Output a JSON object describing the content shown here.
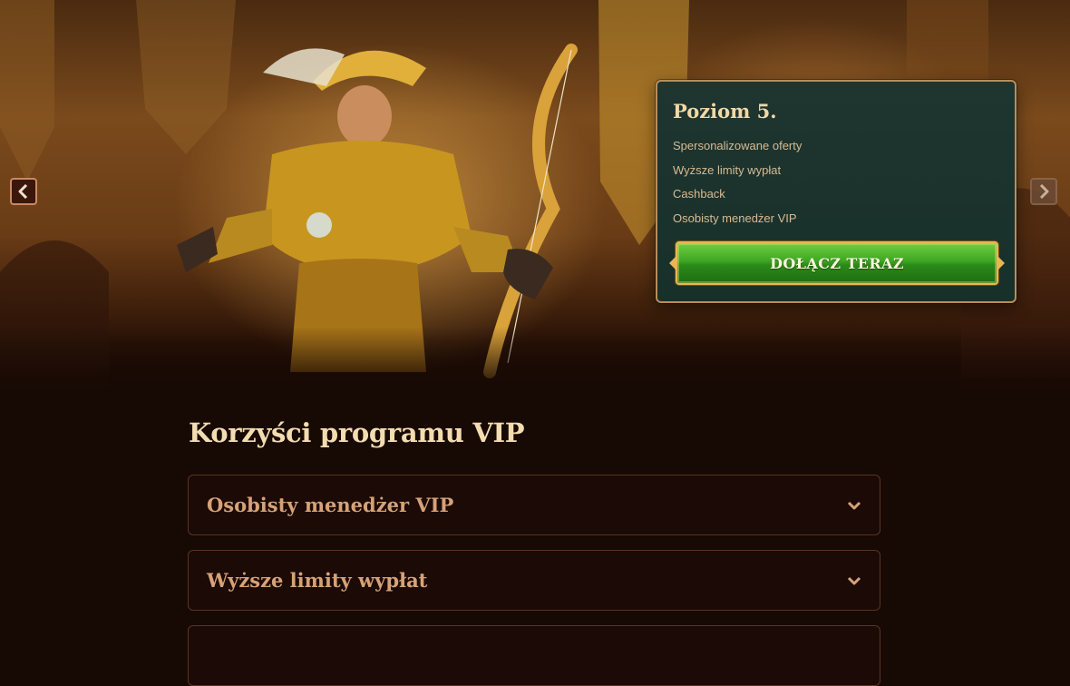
{
  "hero": {
    "prev_icon": "chevron-left-icon",
    "next_icon": "chevron-right-icon"
  },
  "level_card": {
    "title": "Poziom 5.",
    "features": [
      "Spersonalizowane oferty",
      "Wyższe limity wypłat",
      "Cashback",
      "Osobisty menedżer VIP"
    ],
    "join_label": "DOŁĄCZ TERAZ"
  },
  "vip_section": {
    "heading": "Korzyści programu VIP",
    "items": [
      {
        "label": "Osobisty menedżer VIP",
        "icon": "chevron-down-icon"
      },
      {
        "label": "Wyższe limity wypłat",
        "icon": "chevron-down-icon"
      },
      {
        "label": "",
        "icon": "chevron-down-icon"
      }
    ]
  },
  "colors": {
    "page_bg": "#170904",
    "card_bg": "#1f3530",
    "gold_border": "#b98d5a",
    "button_green": "#3ea624",
    "heading_text": "#f3dcb0",
    "accordion_text": "#d6a277"
  }
}
